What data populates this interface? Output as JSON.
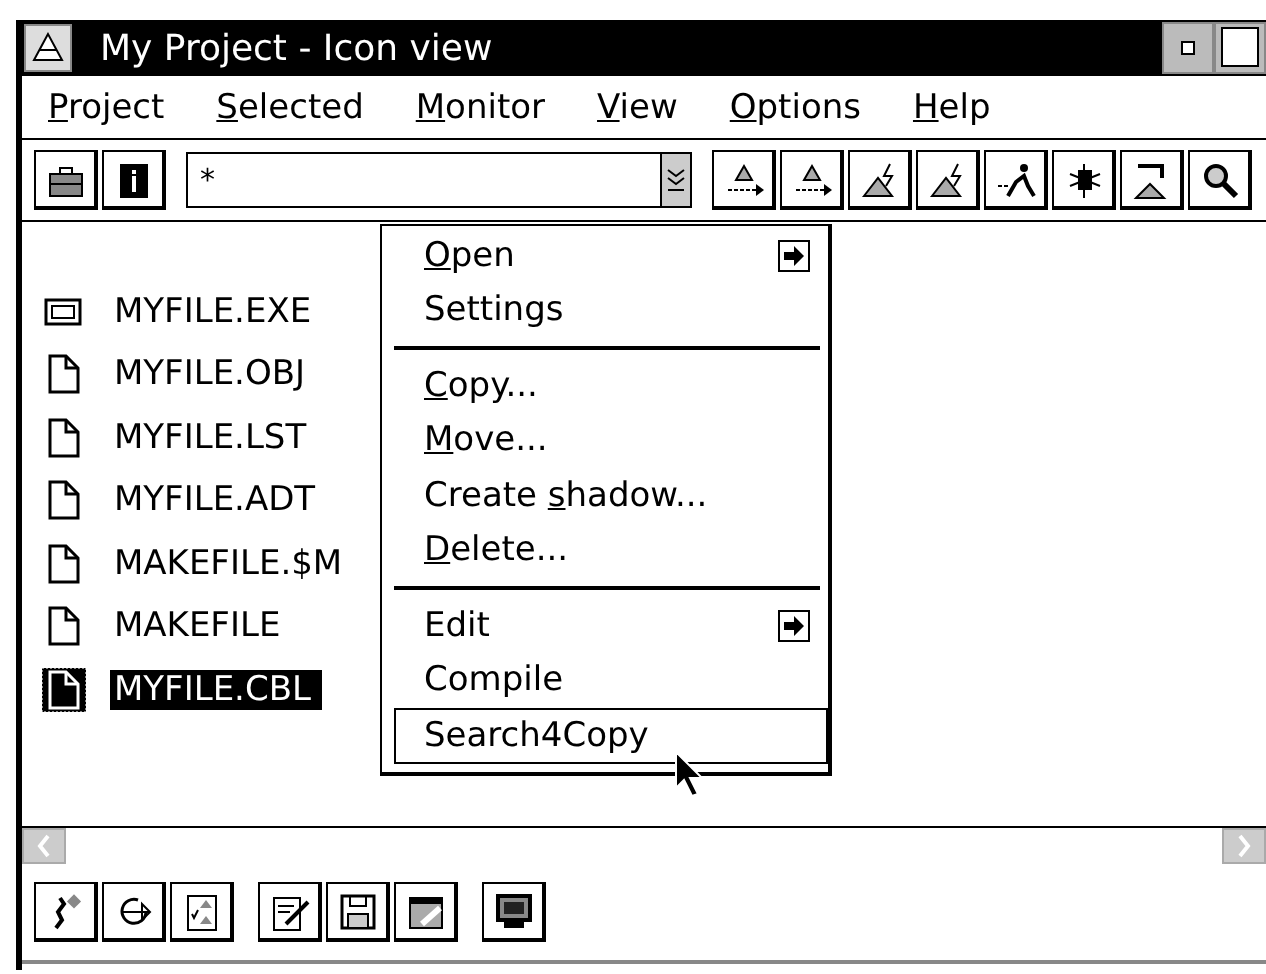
{
  "window": {
    "title": "My Project - Icon view"
  },
  "menu_bar": [
    {
      "mnemonic": "P",
      "rest": "roject"
    },
    {
      "mnemonic": "S",
      "rest": "elected"
    },
    {
      "mnemonic": "M",
      "rest": "onitor"
    },
    {
      "mnemonic": "V",
      "rest": "iew"
    },
    {
      "mnemonic": "O",
      "rest": "ptions"
    },
    {
      "mnemonic": "H",
      "rest": "elp"
    }
  ],
  "filter": {
    "value": "*"
  },
  "files": [
    {
      "name": "MYFILE.EXE",
      "kind": "program",
      "selected": false
    },
    {
      "name": "MYFILE.OBJ",
      "kind": "document",
      "selected": false
    },
    {
      "name": "MYFILE.LST",
      "kind": "document",
      "selected": false
    },
    {
      "name": "MYFILE.ADT",
      "kind": "document",
      "selected": false
    },
    {
      "name": "MAKEFILE.$M",
      "kind": "document",
      "selected": false
    },
    {
      "name": "MAKEFILE",
      "kind": "document",
      "selected": false
    },
    {
      "name": "MYFILE.CBL",
      "kind": "document",
      "selected": true
    }
  ],
  "context_menu": [
    {
      "kind": "item",
      "mnemonic": "O",
      "rest": "pen",
      "submenu": true,
      "selected": false
    },
    {
      "kind": "item",
      "label": "Settings",
      "submenu": false,
      "selected": false
    },
    {
      "kind": "separator"
    },
    {
      "kind": "item",
      "mnemonic": "C",
      "rest": "opy...",
      "submenu": false,
      "selected": false
    },
    {
      "kind": "item",
      "mnemonic": "M",
      "rest": "ove...",
      "submenu": false,
      "selected": false
    },
    {
      "kind": "item",
      "lead": "Create ",
      "mnemonic": "s",
      "rest": "hadow...",
      "submenu": false,
      "selected": false
    },
    {
      "kind": "item",
      "mnemonic": "D",
      "rest": "elete...",
      "submenu": false,
      "selected": false
    },
    {
      "kind": "separator"
    },
    {
      "kind": "item",
      "label": "Edit",
      "submenu": true,
      "selected": false
    },
    {
      "kind": "item",
      "label": "Compile",
      "submenu": false,
      "selected": false
    },
    {
      "kind": "item",
      "label": "Search4Copy",
      "submenu": false,
      "selected": true
    }
  ]
}
